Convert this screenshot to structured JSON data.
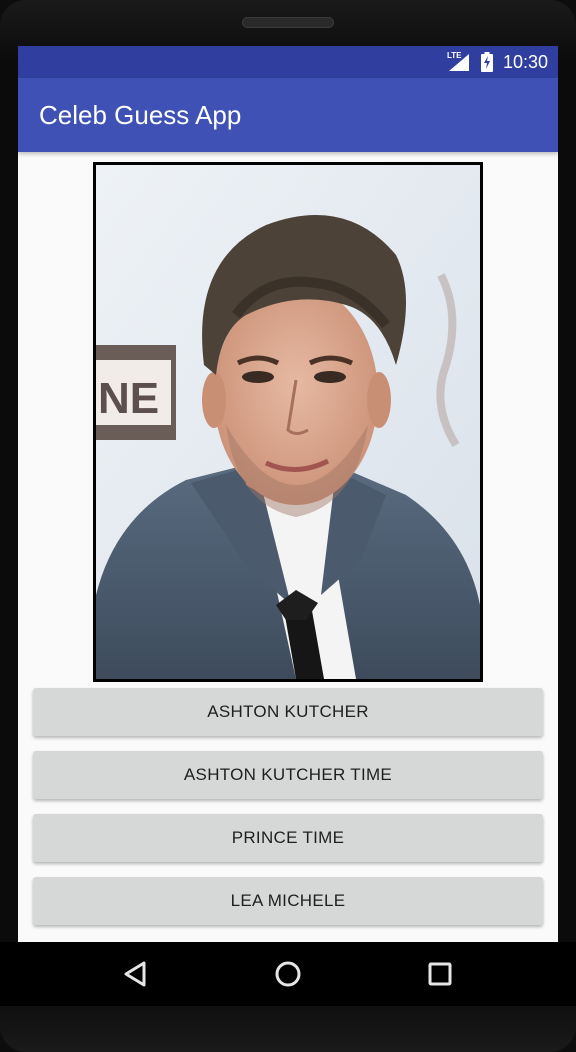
{
  "status_bar": {
    "network_label": "LTE",
    "time": "10:30",
    "icons": [
      "lte-signal-icon",
      "battery-charging-icon"
    ]
  },
  "app_bar": {
    "title": "Celeb Guess App"
  },
  "celebrity_image": {
    "description_icon": "celebrity-photo"
  },
  "answers": [
    {
      "label": "ASHTON KUTCHER"
    },
    {
      "label": "ASHTON KUTCHER TIME"
    },
    {
      "label": "PRINCE TIME"
    },
    {
      "label": "LEA MICHELE"
    }
  ],
  "nav_bar": {
    "icons": [
      "back-icon",
      "home-icon",
      "recents-icon"
    ]
  },
  "colors": {
    "status_bar": "#303f9f",
    "app_bar": "#3f51b5",
    "button": "#d6d7d7",
    "screen_bg": "#fafafa"
  }
}
